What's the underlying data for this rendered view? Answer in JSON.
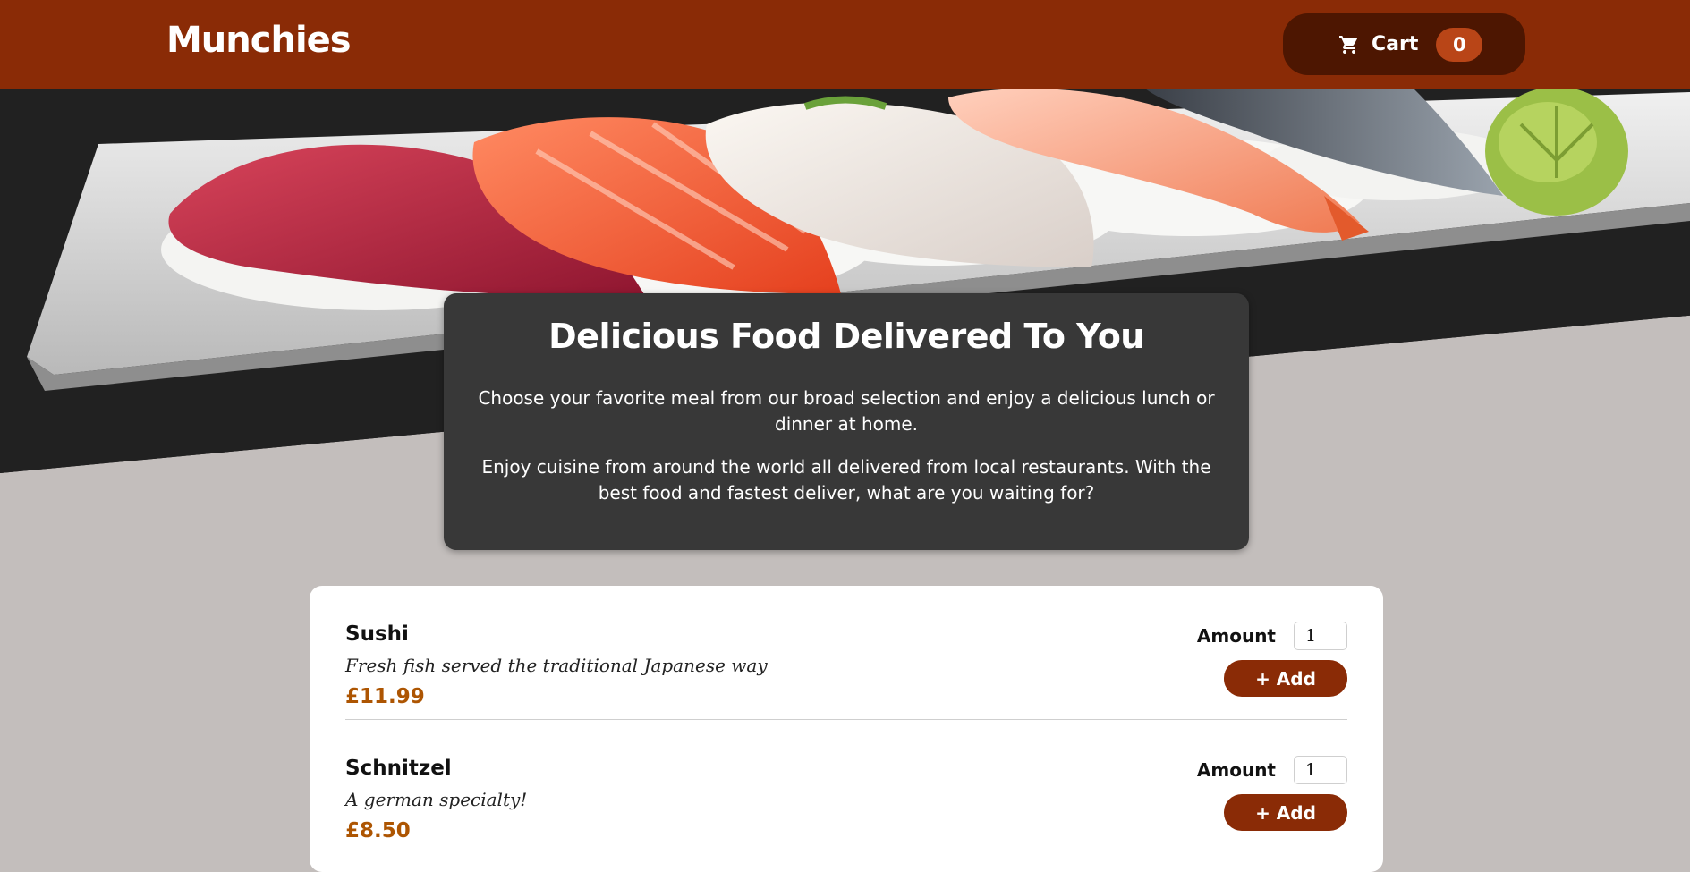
{
  "header": {
    "logo": "Munchies",
    "cart_label": "Cart",
    "cart_count": "0",
    "cart_icon": "shopping-cart-icon"
  },
  "hero": {
    "image_subject": "sushi platter"
  },
  "summary": {
    "title": "Delicious Food Delivered To You",
    "paragraph1": "Choose your favorite meal from our broad selection and enjoy a delicious lunch or dinner at home.",
    "paragraph2": "Enjoy cuisine from around the world all delivered from local restaurants. With the best food and fastest deliver, what are you waiting for?"
  },
  "meals": [
    {
      "name": "Sushi",
      "description": "Fresh fish served the traditional Japanese way",
      "price": "£11.99",
      "amount_label": "Amount",
      "amount_value": "1",
      "add_label": "+ Add"
    },
    {
      "name": "Schnitzel",
      "description": "A german specialty!",
      "price": "£8.50",
      "amount_label": "Amount",
      "amount_value": "1",
      "add_label": "+ Add"
    }
  ],
  "colors": {
    "header_bg": "#8a2b06",
    "cart_bg": "#4d1601",
    "badge_bg": "#b94517",
    "page_bg": "#c3bebc",
    "summary_bg": "#383838",
    "price": "#ad5502"
  }
}
